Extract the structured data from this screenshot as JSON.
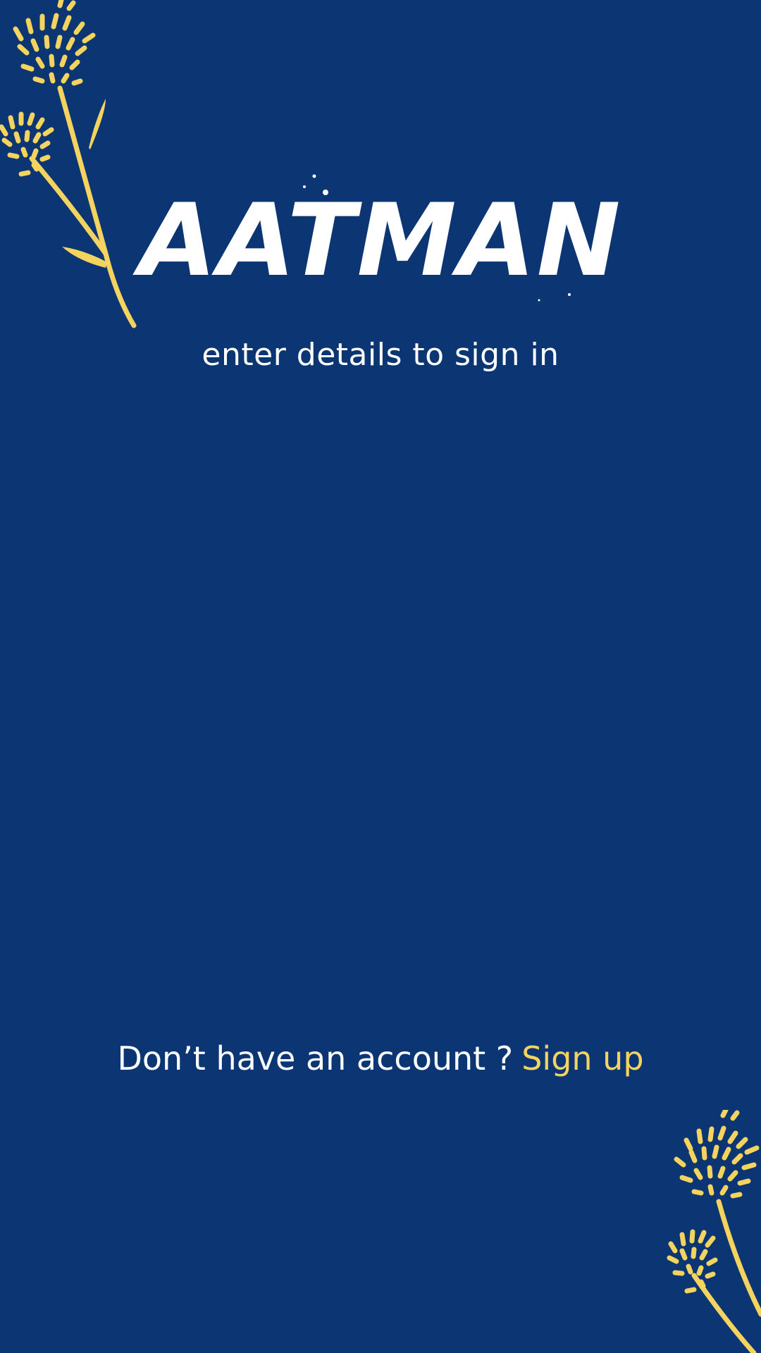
{
  "app": {
    "logo_text": "AATMAN",
    "subtitle": "enter details to sign in"
  },
  "footer": {
    "prompt": "Don’t have an account ?",
    "signup_label": "Sign up"
  },
  "icons": {
    "decoration": "flower-branch-icon"
  },
  "colors": {
    "background": "#0c3673",
    "accent": "#f4d35e",
    "text": "#ffffff"
  }
}
